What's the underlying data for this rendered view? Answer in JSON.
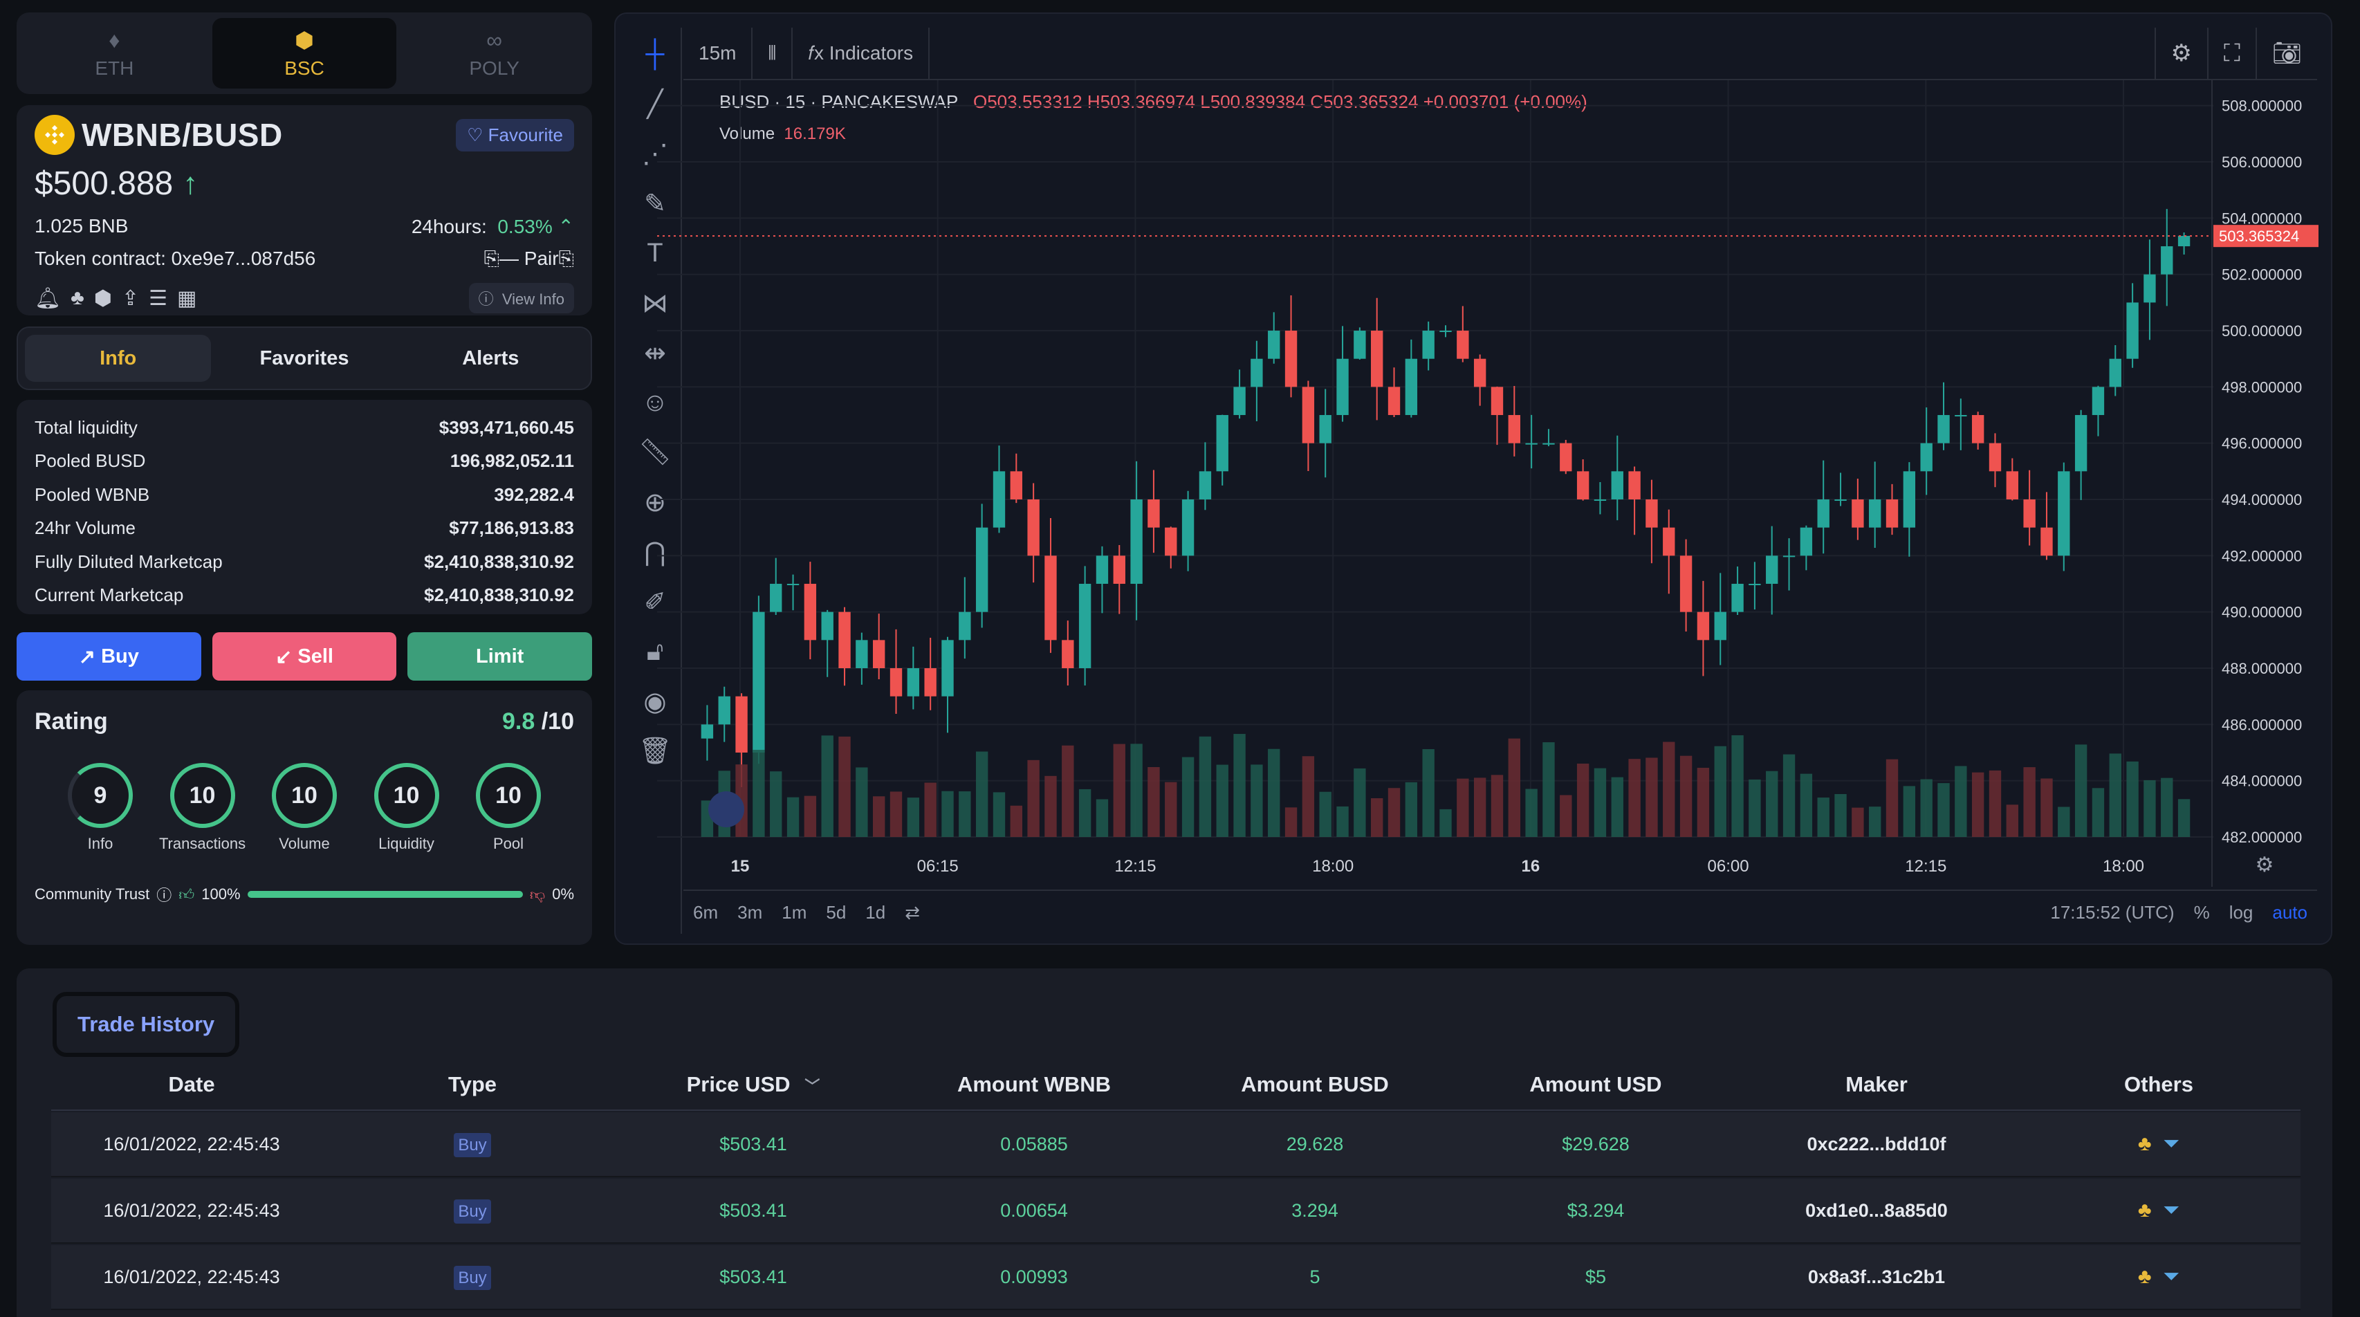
{
  "networks": [
    {
      "label": "ETH",
      "icon": "♦"
    },
    {
      "label": "BSC",
      "icon": "⬢"
    },
    {
      "label": "POLY",
      "icon": "∞"
    }
  ],
  "token": {
    "pair": "WBNB/BUSD",
    "favourite": "Favourite",
    "price": "$500.888",
    "bnb": "1.025 BNB",
    "change_label": "24hours:",
    "change": "0.53%",
    "contract_label": "Token contract: 0xe9e7...087d56",
    "pair_label": "— Pair",
    "view_info": "View Info"
  },
  "tabs": [
    "Info",
    "Favorites",
    "Alerts"
  ],
  "stats": [
    {
      "label": "Total liquidity",
      "value": "$393,471,660.45"
    },
    {
      "label": "Pooled BUSD",
      "value": "196,982,052.11"
    },
    {
      "label": "Pooled WBNB",
      "value": "392,282.4"
    },
    {
      "label": "24hr Volume",
      "value": "$77,186,913.83"
    },
    {
      "label": "Fully Diluted Marketcap",
      "value": "$2,410,838,310.92"
    },
    {
      "label": "Current Marketcap",
      "value": "$2,410,838,310.92"
    }
  ],
  "actions": {
    "buy": "Buy",
    "sell": "Sell",
    "limit": "Limit"
  },
  "rating": {
    "title": "Rating",
    "score": "9.8",
    "outof": "/10",
    "items": [
      {
        "v": "9",
        "l": "Info"
      },
      {
        "v": "10",
        "l": "Transactions"
      },
      {
        "v": "10",
        "l": "Volume"
      },
      {
        "v": "10",
        "l": "Liquidity"
      },
      {
        "v": "10",
        "l": "Pool"
      }
    ],
    "trust_label": "Community Trust",
    "trust_up": "100%",
    "trust_down": "0%"
  },
  "chart": {
    "interval": "15m",
    "indicators": "Indicators",
    "symbol": "BUSD · 15 · PANCAKESWAP",
    "o": "503.553312",
    "h": "503.366974",
    "l": "500.839384",
    "c": "503.365324",
    "chg": "+0.003701 (+0.00%)",
    "volume_label": "Volume",
    "volume": "16.179K",
    "last_price": "503.365324",
    "y_ticks": [
      "508.000000",
      "506.000000",
      "504.000000",
      "502.000000",
      "500.000000",
      "498.000000",
      "496.000000",
      "494.000000",
      "492.000000",
      "490.000000",
      "488.000000",
      "486.000000",
      "484.000000",
      "482.000000"
    ],
    "x_ticks": [
      "15",
      "06:15",
      "12:15",
      "18:00",
      "16",
      "06:00",
      "12:15",
      "18:00"
    ],
    "ranges": [
      "6m",
      "3m",
      "1m",
      "5d",
      "1d"
    ],
    "time": "17:15:52 (UTC)",
    "pct": "%",
    "log": "log",
    "auto": "auto"
  },
  "chart_data": {
    "type": "candlestick",
    "title": "BUSD · 15 · PANCAKESWAP",
    "ylim": [
      482,
      508
    ],
    "close_series": [
      486,
      487,
      485,
      490,
      491,
      491,
      489,
      490,
      488,
      489,
      488,
      487,
      488,
      487,
      489,
      490,
      493,
      495,
      494,
      492,
      489,
      488,
      491,
      492,
      491,
      494,
      493,
      492,
      494,
      495,
      497,
      498,
      499,
      500,
      498,
      496,
      497,
      499,
      500,
      498,
      497,
      499,
      500,
      500,
      499,
      498,
      497,
      496,
      496,
      496,
      495,
      494,
      494,
      495,
      494,
      493,
      492,
      490,
      489,
      490,
      491,
      491,
      492,
      492,
      493,
      494,
      494,
      493,
      494,
      493,
      495,
      496,
      497,
      497,
      496,
      495,
      494,
      493,
      492,
      495,
      497,
      498,
      499,
      501,
      502,
      503,
      503.37
    ]
  },
  "history": {
    "tab": "Trade History",
    "columns": [
      "Date",
      "Type",
      "Price USD",
      "Amount WBNB",
      "Amount BUSD",
      "Amount USD",
      "Maker",
      "Others"
    ],
    "rows": [
      {
        "date": "16/01/2022, 22:45:43",
        "type": "Buy",
        "price": "$503.41",
        "wbnb": "0.05885",
        "busd": "29.628",
        "usd": "$29.628",
        "maker": "0xc222...bdd10f"
      },
      {
        "date": "16/01/2022, 22:45:43",
        "type": "Buy",
        "price": "$503.41",
        "wbnb": "0.00654",
        "busd": "3.294",
        "usd": "$3.294",
        "maker": "0xd1e0...8a85d0"
      },
      {
        "date": "16/01/2022, 22:45:43",
        "type": "Buy",
        "price": "$503.41",
        "wbnb": "0.00993",
        "busd": "5",
        "usd": "$5",
        "maker": "0x8a3f...31c2b1"
      }
    ]
  }
}
